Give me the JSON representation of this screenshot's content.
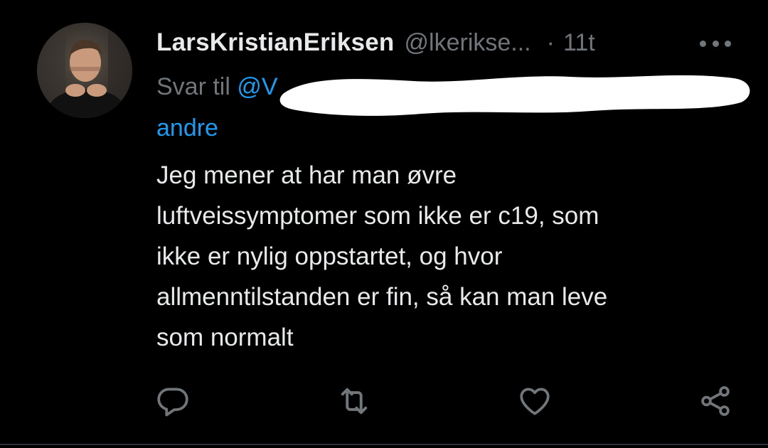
{
  "tweet": {
    "display_name": "LarsKristianEriksen",
    "handle": "@lkerikse...",
    "separator": "·",
    "time": "11t",
    "reply": {
      "prefix": "Svar til",
      "mention_visible": "@V",
      "mention_line2": "andre"
    },
    "text_lines": [
      "Jeg mener at har man øvre",
      "luftveissymptomer som ikke er c19, som",
      "ikke er nylig oppstartet, og hvor",
      "allmenntilstanden er fin, så kan man leve",
      "som normalt"
    ]
  },
  "icons": {
    "more": "more-horizontal-icon",
    "reply": "reply-bubble-icon",
    "retweet": "retweet-icon",
    "like": "heart-icon",
    "share": "share-icon"
  },
  "colors": {
    "background": "#000000",
    "primary_text": "#e7e9ea",
    "secondary_text": "#71767b",
    "link": "#1d9bf0",
    "redaction": "#ffffff"
  }
}
